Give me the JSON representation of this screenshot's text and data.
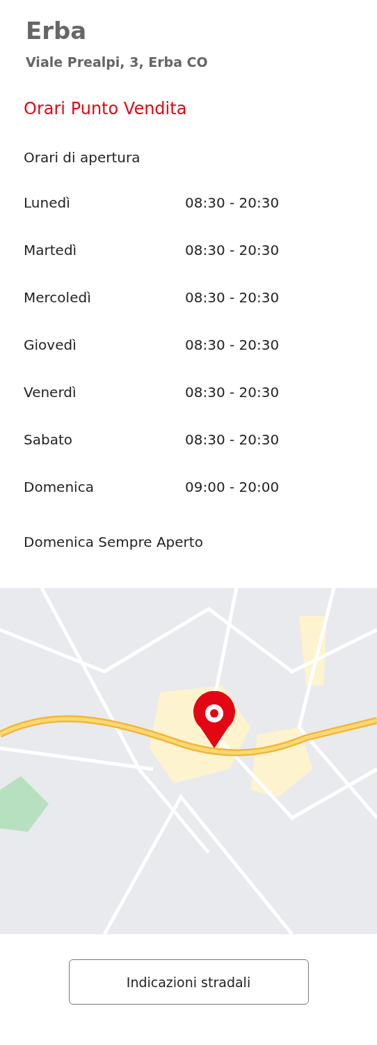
{
  "store": {
    "name": "Erba",
    "address": "Viale Prealpi, 3, Erba CO"
  },
  "hours_heading": "Orari Punto Vendita",
  "hours_subheading": "Orari di apertura",
  "hours": [
    {
      "day": "Lunedì",
      "time": "08:30 - 20:30"
    },
    {
      "day": "Martedì",
      "time": "08:30 - 20:30"
    },
    {
      "day": "Mercoledì",
      "time": "08:30 - 20:30"
    },
    {
      "day": "Giovedì",
      "time": "08:30 - 20:30"
    },
    {
      "day": "Venerdì",
      "time": "08:30 - 20:30"
    },
    {
      "day": "Sabato",
      "time": "08:30 - 20:30"
    },
    {
      "day": "Domenica",
      "time": "09:00 - 20:00"
    }
  ],
  "note": "Domenica Sempre Aperto",
  "directions_button": "Indicazioni stradali"
}
